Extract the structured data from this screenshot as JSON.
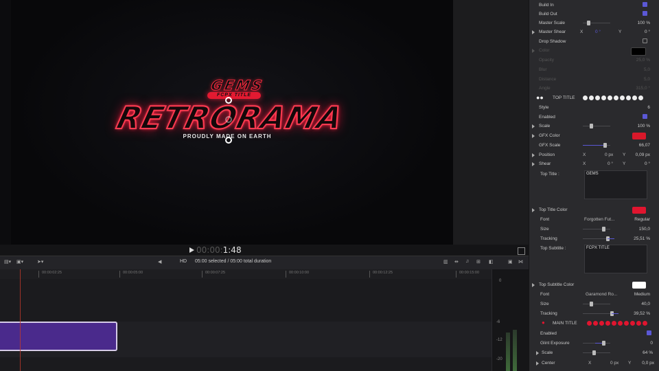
{
  "viewer": {
    "title_top": "GEMS",
    "title_pill": "FCPX TITLE",
    "title_main": "RETRORAMA",
    "tagline": "PROUDLY MADE ON EARTH"
  },
  "playback": {
    "timecode_dim": "00:00:",
    "timecode": "1:48"
  },
  "timeline_toolbar": {
    "format": "HD",
    "selection": "05:00 selected / 05:00 total duration"
  },
  "ruler_ticks": [
    "00:00:02:25",
    "00:00:05:00",
    "00:00:07:25",
    "00:00:10:00",
    "00:00:12:25",
    "00:00:15:00"
  ],
  "meter_labels": [
    "0",
    "-6",
    "-12",
    "-20"
  ],
  "inspector": {
    "build_in": "Build In",
    "build_out": "Build Out",
    "master_scale": {
      "label": "Master Scale",
      "value": "100 %"
    },
    "master_shear": {
      "label": "Master Shear",
      "x_label": "X",
      "x_value": "0 °",
      "y_label": "Y",
      "y_value": "0 °"
    },
    "drop_shadow": "Drop Shadow",
    "shadow_color": "Color",
    "shadow_opacity": {
      "label": "Opacity",
      "value": "25,0 %"
    },
    "shadow_blur": {
      "label": "Blur",
      "value": "5,0"
    },
    "shadow_distance": {
      "label": "Distance",
      "value": "5,0"
    },
    "shadow_angle": {
      "label": "Angle",
      "value": "315,0 °"
    },
    "top_title_header": "TOP TITLE",
    "style": {
      "label": "Style",
      "value": "6"
    },
    "enabled": "Enabled",
    "scale": {
      "label": "Scale",
      "value": "100 %"
    },
    "gfx_color": "GFX Color",
    "gfx_scale": {
      "label": "GFX Scale",
      "value": "66,07"
    },
    "position": {
      "label": "Position",
      "x_label": "X",
      "x_value": "0 px",
      "y_label": "Y",
      "y_value": "0,09 px"
    },
    "shear": {
      "label": "Shear",
      "x_label": "X",
      "x_value": "0 °",
      "y_label": "Y",
      "y_value": "0 °"
    },
    "top_title_text_label": "Top Title :",
    "top_title_text": "GEMS",
    "top_title_color": "Top Title Color",
    "font": {
      "label": "Font",
      "value": "Forgotten Fut...",
      "weight": "Regular"
    },
    "size": {
      "label": "Size",
      "value": "150,0"
    },
    "tracking": {
      "label": "Tracking",
      "value": "25,51 %"
    },
    "top_subtitle_label": "Top Subtitle :",
    "top_subtitle_text": "FCPX TITLE",
    "top_subtitle_color": "Top Subtitle Color",
    "sub_font": {
      "label": "Font",
      "value": "Garamond Ro...",
      "weight": "Medium"
    },
    "sub_size": {
      "label": "Size",
      "value": "40,0"
    },
    "sub_tracking": {
      "label": "Tracking",
      "value": "39,52 %"
    },
    "main_title_header": "MAIN TITLE",
    "main_enabled": "Enabled",
    "glint_exposure": {
      "label": "Glint Exposure",
      "value": "0"
    },
    "main_scale": {
      "label": "Scale",
      "value": "64 %"
    },
    "center": {
      "label": "Center",
      "x_label": "X",
      "x_value": "0 px",
      "y_label": "Y",
      "y_value": "0,0 px"
    }
  },
  "colors": {
    "accent": "#5b58d6",
    "title_red": "#ff2b3f",
    "gfx_color": "#d8182a",
    "top_title_color": "#e0152f",
    "top_subtitle_color": "#ffffff",
    "shadow_color": "#000000",
    "clip": "#4a2a8c"
  }
}
